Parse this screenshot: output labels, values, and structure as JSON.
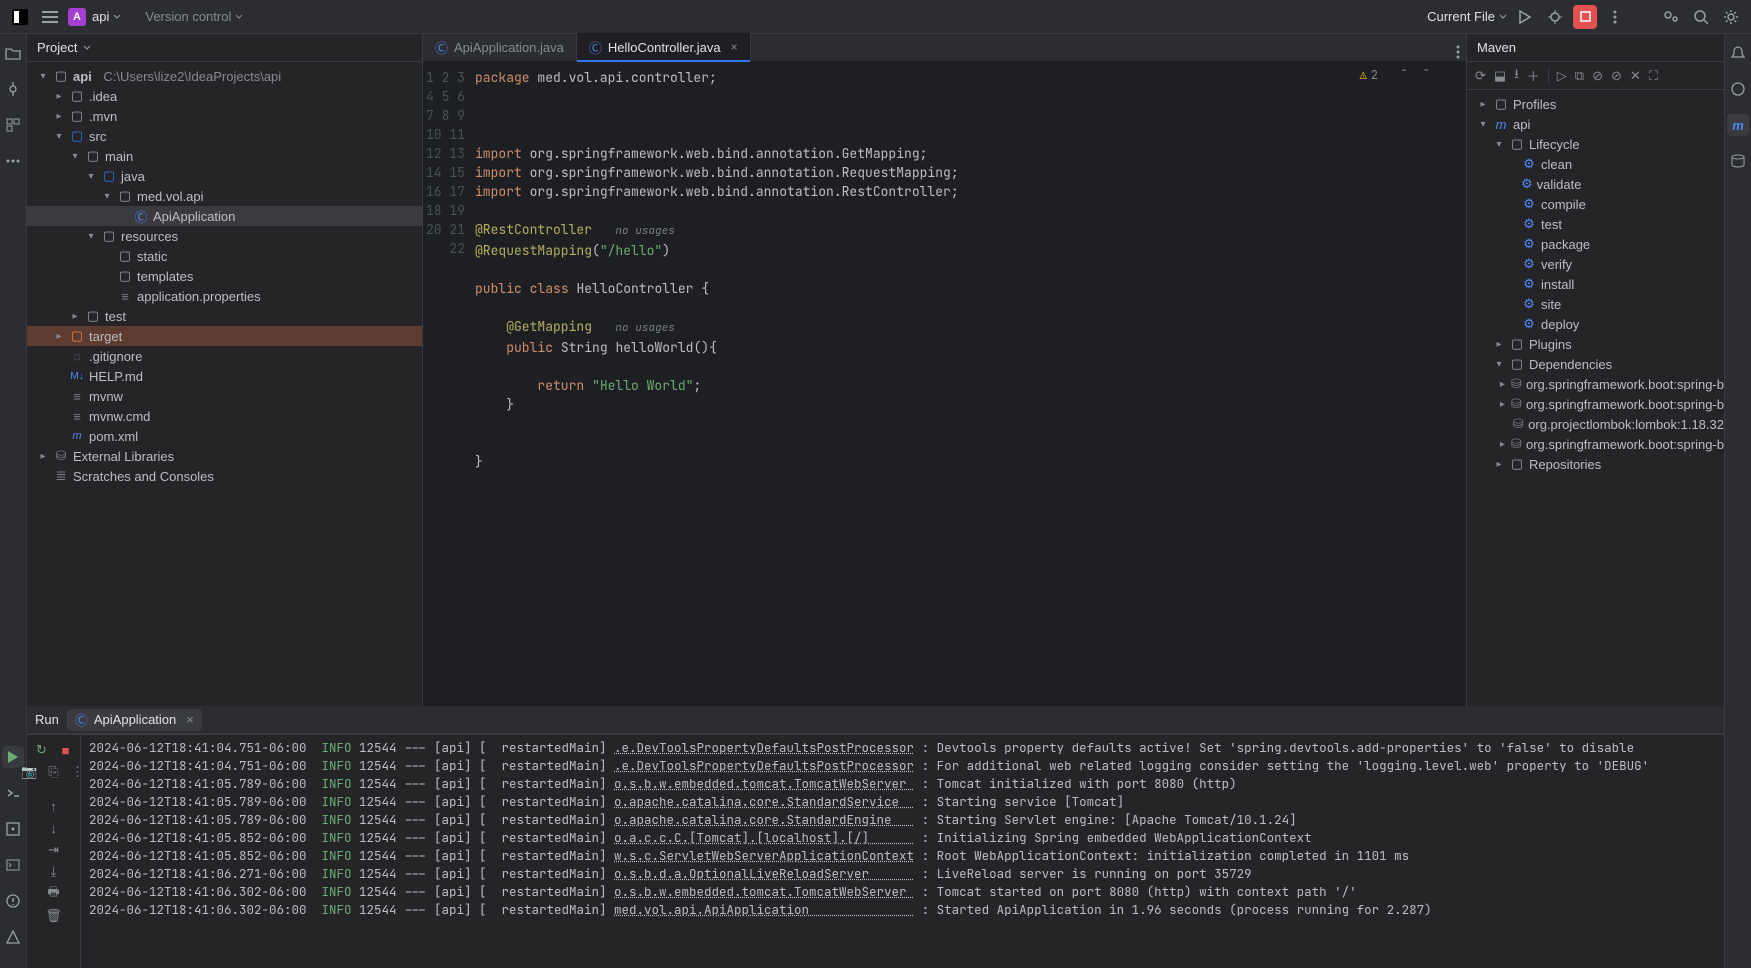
{
  "titlebar": {
    "project_initial": "A",
    "project_name": "api",
    "vcs_label": "Version control",
    "run_config": "Current File"
  },
  "project": {
    "header": "Project",
    "root": {
      "name": "api",
      "path": "C:\\Users\\lize2\\IdeaProjects\\api"
    },
    "nodes": {
      "idea": ".idea",
      "mvn": ".mvn",
      "src": "src",
      "main": "main",
      "java": "java",
      "pkg": "med.vol.api",
      "apiapp": "ApiApplication",
      "resources": "resources",
      "static": "static",
      "templates": "templates",
      "appprops": "application.properties",
      "test": "test",
      "target": "target",
      "gitignore": ".gitignore",
      "help": "HELP.md",
      "mvnw": "mvnw",
      "mvnwcmd": "mvnw.cmd",
      "pom": "pom.xml",
      "ext": "External Libraries",
      "scratch": "Scratches and Consoles"
    }
  },
  "tabs": {
    "t1": "ApiApplication.java",
    "t2": "HelloController.java"
  },
  "problems": {
    "count": "2"
  },
  "code": {
    "l1_kw": "package",
    "l1_rest": " med.vol.api.controller;",
    "l5_kw": "import",
    "l5_rest": " org.springframework.web.bind.annotation.GetMapping;",
    "l6_kw": "import",
    "l6_rest": " org.springframework.web.bind.annotation.RequestMapping;",
    "l7_kw": "import",
    "l7_rest": " org.springframework.web.bind.annotation.RestController;",
    "l9_ann": "@RestController",
    "l9_hint": "no usages",
    "l10_ann": "@RequestMapping",
    "l10_paren_open": "(",
    "l10_str": "\"/hello\"",
    "l10_paren_close": ")",
    "l12_kw1": "public",
    "l12_kw2": "class",
    "l12_name": "HelloController",
    "l12_brace": " {",
    "l14_ann": "@GetMapping",
    "l14_hint": "no usages",
    "l15_kw1": "public",
    "l15_type": "String",
    "l15_name": "helloWorld",
    "l15_rest": "(){",
    "l17_kw": "return",
    "l17_str": "\"Hello World\"",
    "l17_semi": ";",
    "l18": "}",
    "l21": "}"
  },
  "maven": {
    "header": "Maven",
    "profiles": "Profiles",
    "api": "api",
    "lifecycle": "Lifecycle",
    "goals": [
      "clean",
      "validate",
      "compile",
      "test",
      "package",
      "verify",
      "install",
      "site",
      "deploy"
    ],
    "plugins": "Plugins",
    "dependencies": "Dependencies",
    "deps": [
      "org.springframework.boot:spring-b",
      "org.springframework.boot:spring-b",
      "org.projectlombok:lombok:1.18.32",
      "org.springframework.boot:spring-b"
    ],
    "repos": "Repositories"
  },
  "run": {
    "tab_run": "Run",
    "tab_app": "ApiApplication",
    "lines": [
      {
        "ts": "2024-06-12T18:41:04.751-06:00",
        "lvl": "INFO",
        "pid": "12544",
        "thr": "[  restartedMain]",
        "cls": ".e.DevToolsPropertyDefaultsPostProcessor",
        "msg": "Devtools property defaults active! Set 'spring.devtools.add-properties' to 'false' to disable"
      },
      {
        "ts": "2024-06-12T18:41:04.751-06:00",
        "lvl": "INFO",
        "pid": "12544",
        "thr": "[  restartedMain]",
        "cls": ".e.DevToolsPropertyDefaultsPostProcessor",
        "msg": "For additional web related logging consider setting the 'logging.level.web' property to 'DEBUG'"
      },
      {
        "ts": "2024-06-12T18:41:05.789-06:00",
        "lvl": "INFO",
        "pid": "12544",
        "thr": "[  restartedMain]",
        "cls": "o.s.b.w.embedded.tomcat.TomcatWebServer",
        "msg": "Tomcat initialized with port 8080 (http)"
      },
      {
        "ts": "2024-06-12T18:41:05.789-06:00",
        "lvl": "INFO",
        "pid": "12544",
        "thr": "[  restartedMain]",
        "cls": "o.apache.catalina.core.StandardService",
        "msg": "Starting service [Tomcat]"
      },
      {
        "ts": "2024-06-12T18:41:05.789-06:00",
        "lvl": "INFO",
        "pid": "12544",
        "thr": "[  restartedMain]",
        "cls": "o.apache.catalina.core.StandardEngine",
        "msg": "Starting Servlet engine: [Apache Tomcat/10.1.24]"
      },
      {
        "ts": "2024-06-12T18:41:05.852-06:00",
        "lvl": "INFO",
        "pid": "12544",
        "thr": "[  restartedMain]",
        "cls": "o.a.c.c.C.[Tomcat].[localhost].[/]",
        "msg": "Initializing Spring embedded WebApplicationContext"
      },
      {
        "ts": "2024-06-12T18:41:05.852-06:00",
        "lvl": "INFO",
        "pid": "12544",
        "thr": "[  restartedMain]",
        "cls": "w.s.c.ServletWebServerApplicationContext",
        "msg": "Root WebApplicationContext: initialization completed in 1101 ms"
      },
      {
        "ts": "2024-06-12T18:41:06.271-06:00",
        "lvl": "INFO",
        "pid": "12544",
        "thr": "[  restartedMain]",
        "cls": "o.s.b.d.a.OptionalLiveReloadServer",
        "msg": "LiveReload server is running on port 35729"
      },
      {
        "ts": "2024-06-12T18:41:06.302-06:00",
        "lvl": "INFO",
        "pid": "12544",
        "thr": "[  restartedMain]",
        "cls": "o.s.b.w.embedded.tomcat.TomcatWebServer",
        "msg": "Tomcat started on port 8080 (http) with context path '/'"
      },
      {
        "ts": "2024-06-12T18:41:06.302-06:00",
        "lvl": "INFO",
        "pid": "12544",
        "thr": "[  restartedMain]",
        "cls": "med.vol.api.ApiApplication",
        "msg": "Started ApiApplication in 1.96 seconds (process running for 2.287)"
      }
    ]
  }
}
